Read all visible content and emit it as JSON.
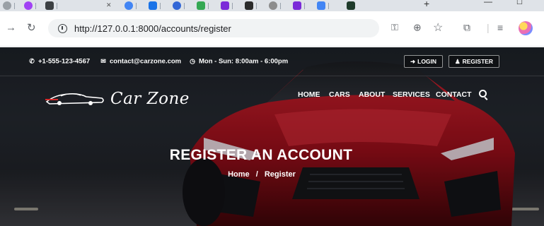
{
  "browser": {
    "url": "http://127.0.0.1:8000/accounts/register",
    "new_tab_label": "+",
    "minimize_label": "—",
    "maximize_label": "☐"
  },
  "icons": [
    "back-arrow-icon",
    "reload-icon",
    "info-icon",
    "key-icon",
    "zoom-icon",
    "star-icon",
    "extensions-icon",
    "reading-list-icon",
    "profile-avatar",
    "phone-icon",
    "envelope-icon",
    "clock-icon",
    "login-icon",
    "user-icon",
    "search-icon"
  ],
  "colors": {
    "hero_dark": "#1c2026",
    "car_red": "#b0121e",
    "text_white": "#ffffff"
  },
  "topbar": {
    "phone": "+1-555-123-4567",
    "email": "contact@carzone.com",
    "hours": "Mon - Sun: 8:00am - 6:00pm",
    "login_label": "LOGIN",
    "register_label": "REGISTER"
  },
  "brand": {
    "logo_text": "Car Zone"
  },
  "nav": {
    "items": [
      "HOME",
      "CARS",
      "ABOUT",
      "SERVICES",
      "CONTACT"
    ]
  },
  "hero": {
    "title": "REGISTER AN ACCOUNT",
    "breadcrumb_home": "Home",
    "breadcrumb_sep": "/",
    "breadcrumb_current": "Register"
  }
}
